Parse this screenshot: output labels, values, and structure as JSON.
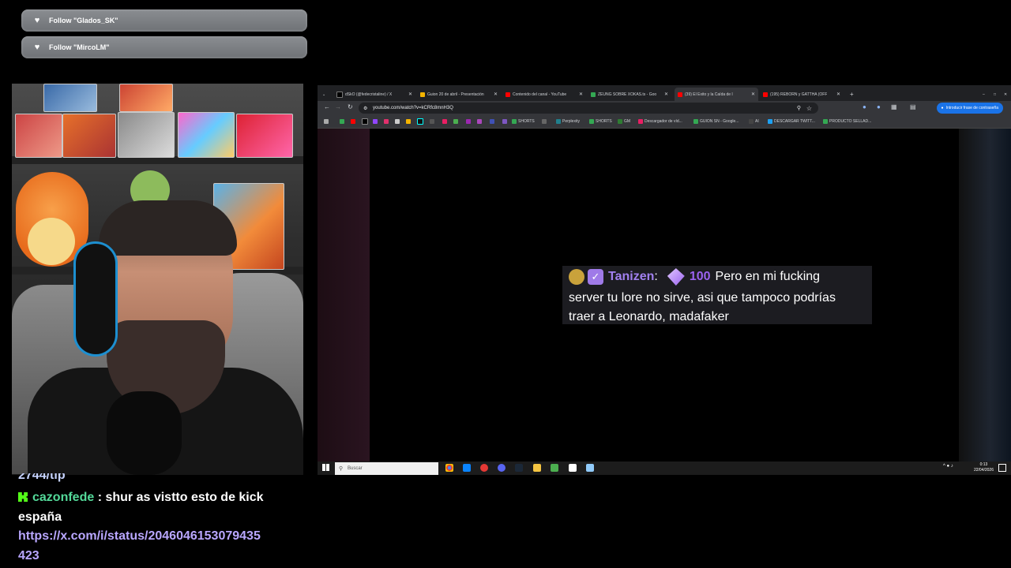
{
  "alerts": [
    {
      "text": "Follow \"Glados_SK\""
    },
    {
      "text": "Follow \"MircoLM\""
    }
  ],
  "chat": {
    "partial_top": "2744/tip",
    "user": "cazonfede",
    "message_line1": " : shur as vistto esto de kick",
    "message_line2": "españa",
    "link_line1": "https://x.com/i/status/2046046153079435",
    "link_line2": "423"
  },
  "browser": {
    "tabs": [
      {
        "label": "dSkO (@fedecristaline) / X"
      },
      {
        "label": "Guion 20 de abril - Presentación"
      },
      {
        "label": "Contenido del canal - YouTube"
      },
      {
        "label": "ZEUNG SOBRE XOKAS.ts - Goo"
      },
      {
        "label": "(39) El Éxito y la Caída de l"
      },
      {
        "label": "(195) REBORN y GATTHA (OFF"
      }
    ],
    "url": "youtube.com/watch?v=kCRfc8mnH3Q",
    "password_button": "Introducir frase de contraseña",
    "bookmarks": [
      "SHORTS",
      "Perplexity",
      "SHORTS",
      "GM",
      "Descargador de víd...",
      "GUION SN - Google...",
      "AI",
      "DESCARGAR TWITT...",
      "PRODUCTO SELLAD..."
    ]
  },
  "overlay": {
    "username": "Tanizen",
    "separator": ":",
    "bits": "100",
    "line1_text": "Pero en mi fucking",
    "line2_text": "server tu lore no sirve, asi que tampoco podrías",
    "line3_text": "traer a Leonardo, madafaker"
  },
  "taskbar": {
    "search_placeholder": "Buscar",
    "time": "0:13",
    "date": "22/04/2026"
  }
}
